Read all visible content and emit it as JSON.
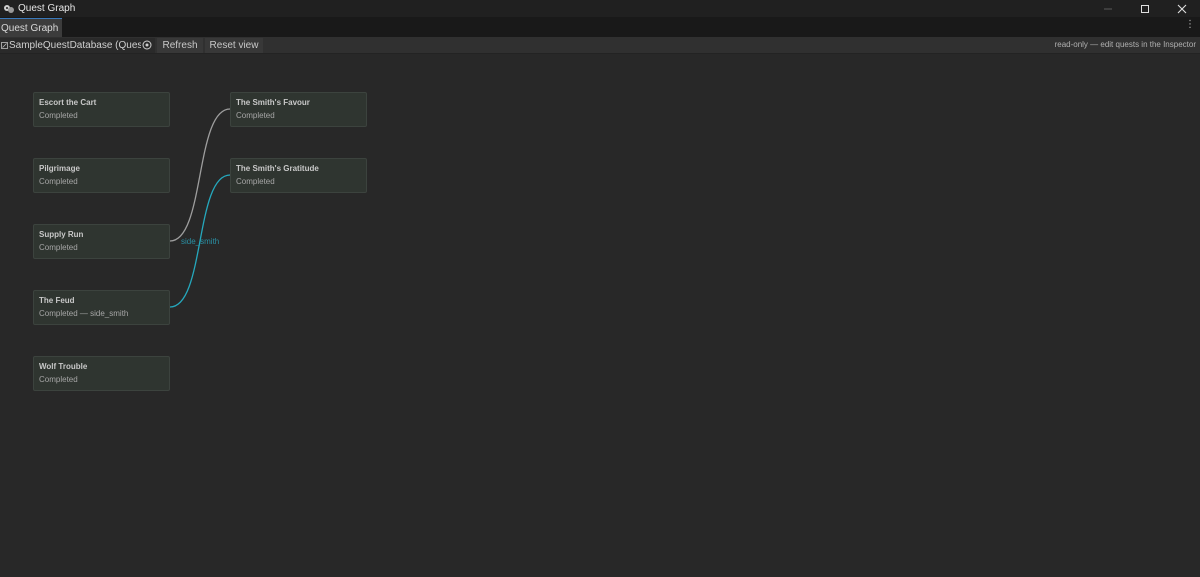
{
  "window": {
    "title": "Quest Graph",
    "icons": [
      "quest-graph-app-icon",
      "minimize-icon",
      "maximize-icon",
      "close-icon"
    ]
  },
  "tabs": [
    {
      "label": "Quest Graph",
      "active": true
    }
  ],
  "toolbar": {
    "database_value": "SampleQuestDatabase (Ques",
    "refresh_label": "Refresh",
    "reset_view_label": "Reset view",
    "note": "read-only — edit quests in the Inspector"
  },
  "nodes": [
    {
      "title": "Escort the Cart",
      "status": "Completed"
    },
    {
      "title": "Pilgrimage",
      "status": "Completed"
    },
    {
      "title": "Supply Run",
      "status": "Completed"
    },
    {
      "title": "The Feud",
      "status": "Completed — side_smith"
    },
    {
      "title": "Wolf Trouble",
      "status": "Completed"
    },
    {
      "title": "The Smith's Favour",
      "status": "Completed"
    },
    {
      "title": "The Smith's Gratitude",
      "status": "Completed"
    }
  ],
  "edges": [
    {
      "from": "Supply Run",
      "to": "The Smith's Favour",
      "color": "#9e9e9e",
      "label": ""
    },
    {
      "from": "The Feud",
      "to": "The Smith's Gratitude",
      "color": "#25a8bd",
      "label": "side_smith"
    }
  ],
  "colors": {
    "background": "#282828",
    "node_fill": "#2f3530",
    "tab_accent": "#3a79bb",
    "edge_accent": "#25a8bd"
  }
}
